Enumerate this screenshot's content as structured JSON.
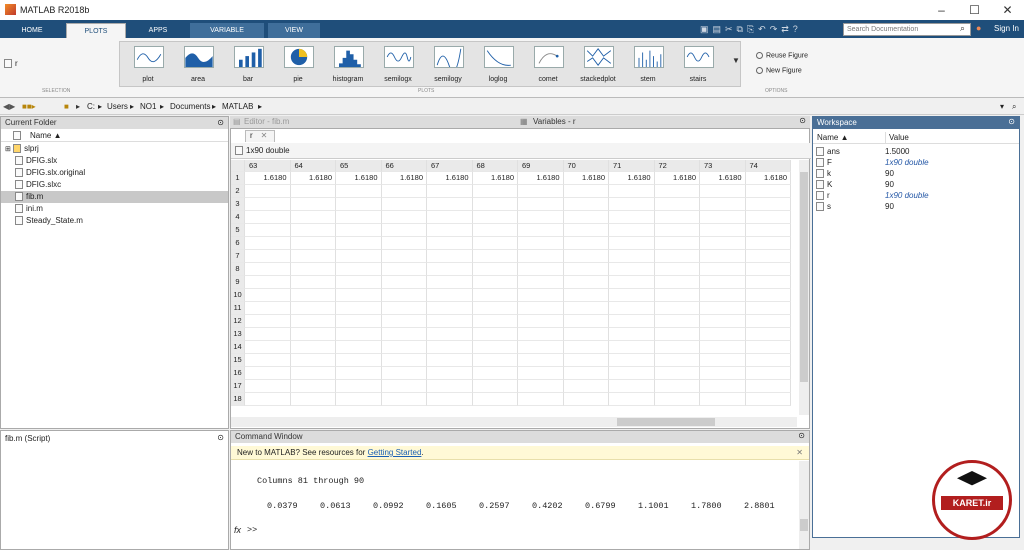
{
  "window": {
    "title": "MATLAB R2018b",
    "min": "–",
    "max": "☐",
    "close": "✕"
  },
  "tabs": [
    {
      "label": "HOME"
    },
    {
      "label": "PLOTS"
    },
    {
      "label": "APPS"
    },
    {
      "label": "VARIABLE"
    },
    {
      "label": "VIEW"
    }
  ],
  "search_placeholder": "Search Documentation",
  "sign_in": "Sign In",
  "selection": {
    "var_name": "r",
    "section": "SELECTION"
  },
  "plots": {
    "items": [
      "plot",
      "area",
      "bar",
      "pie",
      "histogram",
      "semilogx",
      "semilogy",
      "loglog",
      "comet",
      "stackedplot",
      "stem",
      "stairs"
    ],
    "section": "PLOTS"
  },
  "options": {
    "reuse": "Reuse Figure",
    "new": "New Figure",
    "section": "OPTIONS"
  },
  "path": {
    "parts": [
      "C:",
      "Users",
      "NO1",
      "Documents",
      "MATLAB"
    ]
  },
  "current_folder": {
    "title": "Current Folder",
    "col_name": "Name ▲",
    "files": [
      "slprj",
      "DFIG.slx",
      "DFIG.slx.original",
      "DFIG.slxc",
      "fib.m",
      "ini.m",
      "Steady_State.m"
    ]
  },
  "details": {
    "title": "fib.m  (Script)"
  },
  "editor": {
    "tab_label": "Editor - fib.m"
  },
  "variables": {
    "tab_label": "Variables - r",
    "var_tab": "r",
    "info": "1x90 double",
    "columns": [
      "63",
      "64",
      "65",
      "66",
      "67",
      "68",
      "69",
      "70",
      "71",
      "72",
      "73",
      "74"
    ],
    "values": [
      "1.6180",
      "1.6180",
      "1.6180",
      "1.6180",
      "1.6180",
      "1.6180",
      "1.6180",
      "1.6180",
      "1.6180",
      "1.6180",
      "1.6180",
      "1.6180"
    ],
    "rows": [
      "1",
      "2",
      "3",
      "4",
      "5",
      "6",
      "7",
      "8",
      "9",
      "10",
      "11",
      "12",
      "13",
      "14",
      "15",
      "16",
      "17",
      "18"
    ]
  },
  "command": {
    "title": "Command Window",
    "banner_text": "New to MATLAB? See resources for ",
    "banner_link": "Getting Started",
    "columns_line": "Columns 81 through 90",
    "numbers": [
      "0.0379",
      "0.0613",
      "0.0992",
      "0.1605",
      "0.2597",
      "0.4202",
      "0.6799",
      "1.1001",
      "1.7800",
      "2.8801"
    ],
    "prompt": ">>"
  },
  "workspace": {
    "title": "Workspace",
    "col_name": "Name ▲",
    "col_value": "Value",
    "vars": [
      {
        "name": "ans",
        "value": "1.5000"
      },
      {
        "name": "F",
        "value": "1x90 double"
      },
      {
        "name": "k",
        "value": "90"
      },
      {
        "name": "K",
        "value": "90"
      },
      {
        "name": "r",
        "value": "1x90 double"
      },
      {
        "name": "s",
        "value": "90"
      }
    ]
  },
  "watermark": {
    "brand": "KARET.ir"
  },
  "colors": {
    "ribbon_tab": "#1f4e7a",
    "panel_header": "#4a6f96",
    "banner": "#fff9d6",
    "link": "#1a5fb4"
  }
}
